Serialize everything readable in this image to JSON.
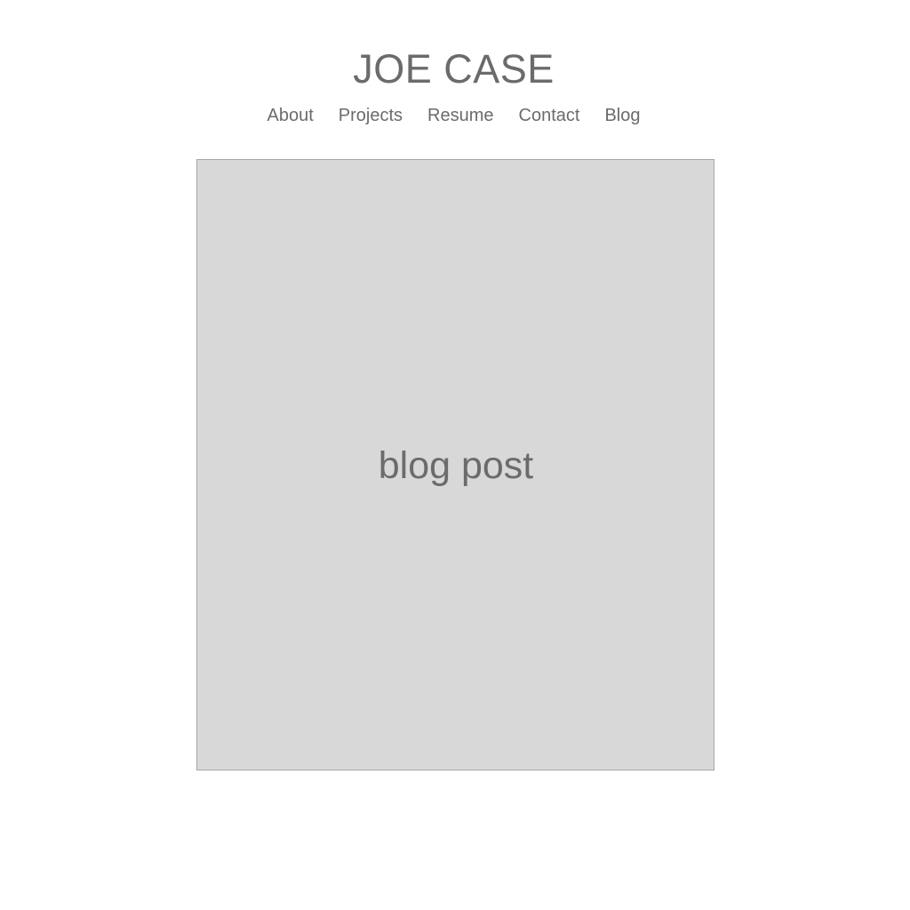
{
  "header": {
    "title": "JOE CASE"
  },
  "nav": {
    "items": [
      {
        "label": "About"
      },
      {
        "label": "Projects"
      },
      {
        "label": "Resume"
      },
      {
        "label": "Contact"
      },
      {
        "label": "Blog"
      }
    ]
  },
  "main": {
    "placeholder_label": "blog post"
  },
  "colors": {
    "text": "#6b6b6b",
    "box_fill": "#d8d8d8",
    "box_border": "#a6a6a6",
    "background": "#ffffff"
  }
}
